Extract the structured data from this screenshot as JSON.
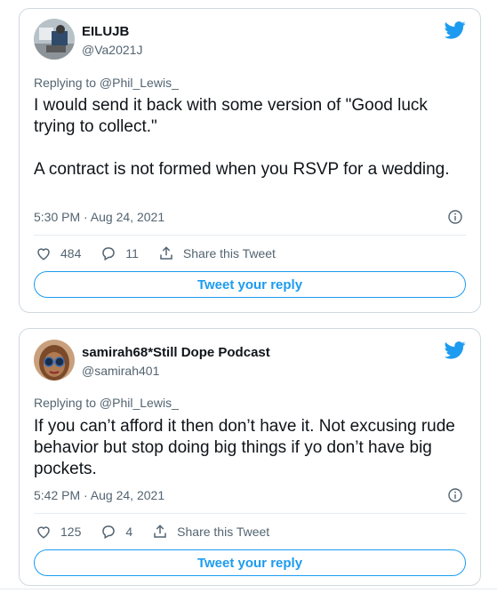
{
  "colors": {
    "accent": "#1d9bf0",
    "muted": "#536471",
    "text": "#0f1419"
  },
  "tweets": [
    {
      "display_name": "EILUJB",
      "handle": "@Va2021J",
      "replying_to": "Replying to @Phil_Lewis_",
      "text": "I would send it back with some version of \"Good luck trying to collect.\"\n\nA contract is not formed when you RSVP for a wedding.",
      "time": "5:30 PM · Aug 24, 2021",
      "likes": "484",
      "replies": "11",
      "share_label": "Share this Tweet",
      "reply_button": "Tweet your reply"
    },
    {
      "display_name": "samirah68*Still Dope Podcast",
      "handle": "@samirah401",
      "replying_to": "Replying to @Phil_Lewis_",
      "text": "If you can’t afford it then don’t have it. Not excusing rude behavior but stop doing big things if yo don’t have big pockets.",
      "time": "5:42 PM · Aug 24, 2021",
      "likes": "125",
      "replies": "4",
      "share_label": "Share this Tweet",
      "reply_button": "Tweet your reply"
    }
  ],
  "icons": [
    "twitter-bird-icon",
    "info-icon",
    "heart-icon",
    "reply-icon",
    "share-icon"
  ]
}
